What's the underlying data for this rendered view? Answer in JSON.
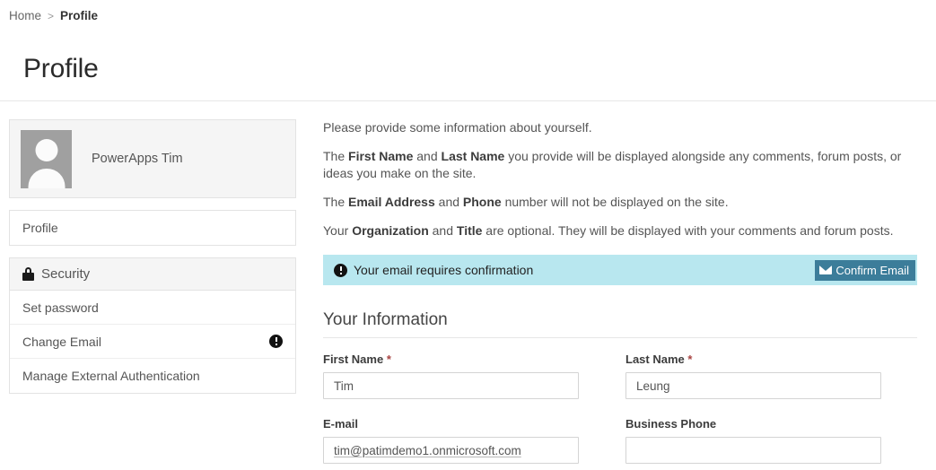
{
  "breadcrumb": {
    "home": "Home",
    "separator": ">",
    "current": "Profile"
  },
  "page": {
    "title": "Profile"
  },
  "sidebar": {
    "user": {
      "name": "PowerApps Tim",
      "avatar_icon": "person-avatar-icon"
    },
    "profile_link": "Profile",
    "security": {
      "header": "Security",
      "lock_icon": "lock-icon",
      "items": [
        {
          "label": "Set password",
          "icon": ""
        },
        {
          "label": "Change Email",
          "icon": "exclamation-circle-icon"
        },
        {
          "label": "Manage External Authentication",
          "icon": ""
        }
      ]
    }
  },
  "main": {
    "intro": {
      "line1": "Please provide some information about yourself.",
      "line2_a": "The ",
      "line2_b1": "First Name",
      "line2_c": " and ",
      "line2_b2": "Last Name",
      "line2_d": " you provide will be displayed alongside any comments, forum posts, or ideas you make on the site.",
      "line3_a": "The ",
      "line3_b1": "Email Address",
      "line3_c": " and ",
      "line3_b2": "Phone",
      "line3_d": " number will not be displayed on the site.",
      "line4_a": "Your ",
      "line4_b1": "Organization",
      "line4_c": " and ",
      "line4_b2": "Title",
      "line4_d": " are optional. They will be displayed with your comments and forum posts."
    },
    "alert": {
      "icon": "exclamation-circle-icon",
      "message": "Your email requires confirmation",
      "button_label": "Confirm Email",
      "button_icon": "envelope-icon",
      "background_color": "#b8e7ef",
      "button_color": "#3c7d9a"
    },
    "section": {
      "title": "Your Information"
    },
    "fields": {
      "first_name": {
        "label": "First Name",
        "required": "*",
        "value": "Tim",
        "placeholder": ""
      },
      "last_name": {
        "label": "Last Name",
        "required": "*",
        "value": "Leung",
        "placeholder": ""
      },
      "email": {
        "label": "E-mail",
        "value": "tim@patimdemo1.onmicrosoft.com",
        "placeholder": ""
      },
      "business_phone": {
        "label": "Business Phone",
        "value": "",
        "placeholder": ""
      }
    }
  }
}
